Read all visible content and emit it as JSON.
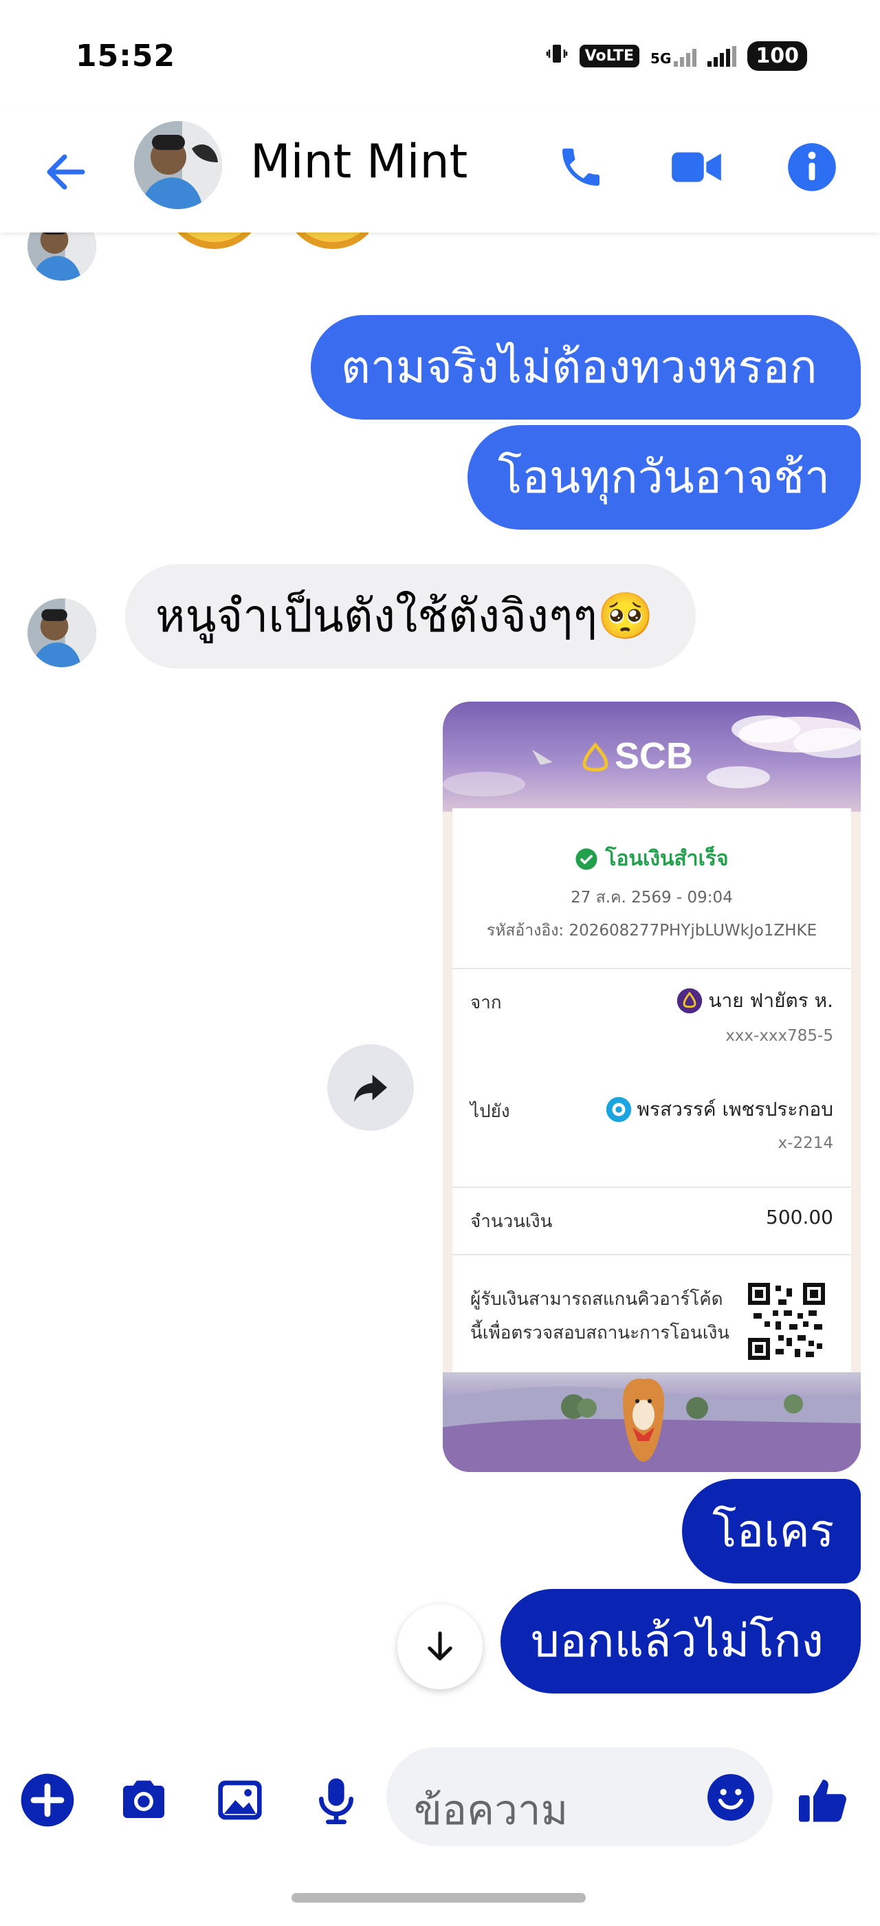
{
  "status_bar": {
    "time": "15:52",
    "volte_label": "VoLTE",
    "network_label": "5G",
    "battery": "100"
  },
  "header": {
    "contact_name": "Mint Mint",
    "accent_color": "#2d6ff2"
  },
  "messages": [
    {
      "direction": "outgoing",
      "text": "ตามจริงไม่ต้องทวงหรอก"
    },
    {
      "direction": "outgoing",
      "text": "โอนทุกวันอาจช้า"
    },
    {
      "direction": "incoming",
      "text": "หนูจำเป็นตังใช้ตังจิงๆๆ🥺"
    },
    {
      "direction": "outgoing",
      "type": "image",
      "image": "scb-transfer-slip"
    },
    {
      "direction": "outgoing",
      "text": "โอเคร"
    },
    {
      "direction": "outgoing",
      "text": "บอกแล้วไม่โกง"
    }
  ],
  "slip": {
    "bank_logo": "SCB",
    "status": "โอนเงินสำเร็จ",
    "datetime": "27 ส.ค. 2569 - 09:04",
    "reference": "รหัสอ้างอิง: 202608277PHYjbLUWkJo1ZHKE",
    "from_label": "จาก",
    "from_name": "นาย ฟายัตร ห.",
    "from_account": "xxx-xxx785-5",
    "to_label": "ไปยัง",
    "to_name": "พรสวรรค์ เพชรประกอบ",
    "to_account": "x-2214",
    "amount_label": "จำนวนเงิน",
    "amount": "500.00",
    "qr_note": "ผู้รับเงินสามารถสแกนคิวอาร์โค้ดนี้เพื่อตรวจสอบสถานะการโอนเงิน"
  },
  "composer": {
    "placeholder": "ข้อความ"
  }
}
